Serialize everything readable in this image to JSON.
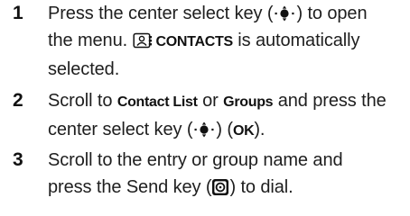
{
  "steps": [
    {
      "number": "1",
      "line1_text": "Press the center select key (",
      "line1_icon": "center-select-key-icon",
      "line1_after": ") to open",
      "line2_text": "the menu.",
      "line2_icon": "contacts-icon",
      "line2_term": "CONTACTS",
      "line2_after": " is automatically",
      "line3_text": "selected."
    },
    {
      "number": "2",
      "line1_before": "Scroll to ",
      "line1_term1": "Contact List",
      "line1_mid": " or ",
      "line1_term2": "Groups",
      "line1_after": " and press the",
      "line2_before": "center select key (",
      "line2_icon": "center-select-key-icon",
      "line2_mid": ") (",
      "line2_term": "OK",
      "line2_after": ")."
    },
    {
      "number": "3",
      "line1_text": "Scroll to the entry or group name and",
      "line2_before": "press the Send key (",
      "line2_icon": "send-key-icon",
      "line2_after": ") to dial."
    }
  ]
}
